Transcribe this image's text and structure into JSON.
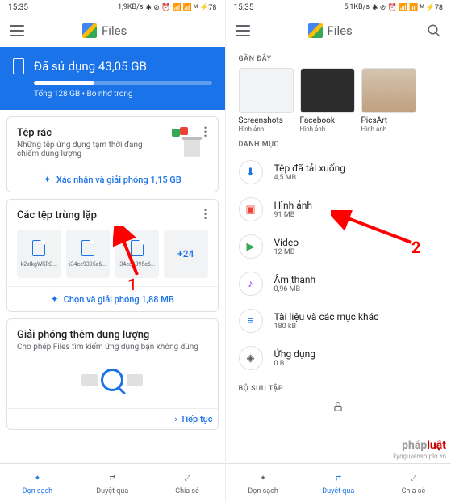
{
  "status": {
    "time": "15:35",
    "speed1": "1,9KB/s",
    "speed2": "5,1KB/s",
    "icons": "⊘ ⊗ ◈ ⫸ ᴹ ⚡78"
  },
  "app": {
    "title": "Files"
  },
  "storage": {
    "title": "Đã sử dụng 43,05 GB",
    "subtitle": "Tổng 128 GB • Bộ nhớ trong"
  },
  "junk": {
    "title": "Tệp rác",
    "subtitle": "Những tệp ứng dụng tạm thời đang chiếm dung lượng",
    "button": "Xác nhận và giải phóng 1,15 GB"
  },
  "duplicates": {
    "title": "Các tệp trùng lặp",
    "items": [
      "k2xIkgWKRC...",
      "i34cc9395e6...",
      "i34cc9395e6..."
    ],
    "more": "+24",
    "button": "Chọn và giải phóng 1,88 MB"
  },
  "freeup": {
    "title": "Giải phóng thêm dung lượng",
    "subtitle": "Cho phép Files tìm kiếm ứng dụng bạn không dùng",
    "button": "Tiếp tục"
  },
  "nav": {
    "clean": "Dọn sạch",
    "browse": "Duyệt qua",
    "share": "Chia sẻ"
  },
  "sections": {
    "recent": "GẦN ĐÂY",
    "categories": "DANH MỤC",
    "collections": "BỘ SƯU TẬP"
  },
  "recent": [
    {
      "name": "Screenshots",
      "type": "Hình ảnh"
    },
    {
      "name": "Facebook",
      "type": "Hình ảnh"
    },
    {
      "name": "PicsArt",
      "type": "Hình ảnh"
    }
  ],
  "categories": [
    {
      "name": "Tệp đã tải xuống",
      "size": "4,5 MB",
      "color": "#1a73e8",
      "icon": "⬇"
    },
    {
      "name": "Hình ảnh",
      "size": "91 MB",
      "color": "#ea4335",
      "icon": "▣"
    },
    {
      "name": "Video",
      "size": "12 MB",
      "color": "#34a853",
      "icon": "▶"
    },
    {
      "name": "Âm thanh",
      "size": "0,96 MB",
      "color": "#a142f4",
      "icon": "♪"
    },
    {
      "name": "Tài liệu và các mục khác",
      "size": "180 kB",
      "color": "#1a73e8",
      "icon": "≡"
    },
    {
      "name": "Ứng dụng",
      "size": "0 B",
      "color": "#5f6368",
      "icon": "◈"
    }
  ],
  "callouts": {
    "n1": "1",
    "n2": "2"
  },
  "watermark": {
    "line1a": "pháp",
    "line1b": "luật",
    "line2": "kynguyenso.plo.vn"
  }
}
